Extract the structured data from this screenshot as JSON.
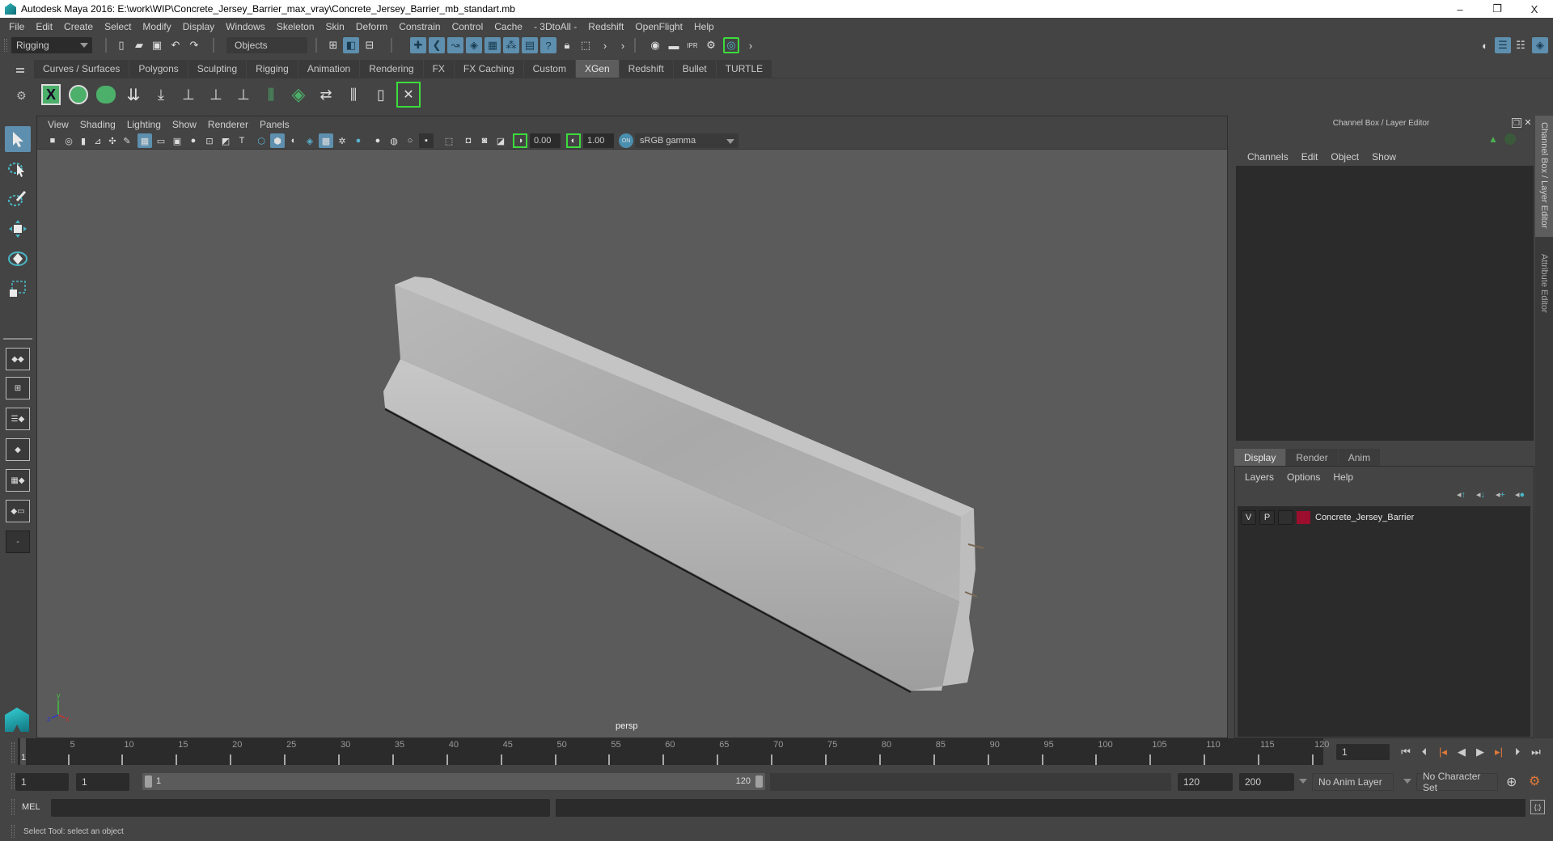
{
  "window": {
    "title": "Autodesk Maya 2016: E:\\work\\WIP\\Concrete_Jersey_Barrier_max_vray\\Concrete_Jersey_Barrier_mb_standart.mb",
    "minimize": "–",
    "restore": "❐",
    "close": "X"
  },
  "menubar": [
    "File",
    "Edit",
    "Create",
    "Select",
    "Modify",
    "Display",
    "Windows",
    "Skeleton",
    "Skin",
    "Deform",
    "Constrain",
    "Control",
    "Cache",
    "- 3DtoAll -",
    "Redshift",
    "OpenFlight",
    "Help"
  ],
  "statusline": {
    "menuset": "Rigging",
    "selection_mode": "Objects"
  },
  "shelf": {
    "tabs": [
      "Curves / Surfaces",
      "Polygons",
      "Sculpting",
      "Rigging",
      "Animation",
      "Rendering",
      "FX",
      "FX Caching",
      "Custom",
      "XGen",
      "Redshift",
      "Bullet",
      "TURTLE"
    ],
    "active_tab": "XGen",
    "icons": [
      "xgen-window-icon",
      "xgen-preview-icon",
      "xgen-clear-preview-icon",
      "add-guides-icon",
      "place-guide-icon",
      "add-guide-icon",
      "sculpt-guide-icon",
      "lock-guide-icon",
      "rebuild-guides-icon",
      "xgen-patch-icon",
      "bend-guide-icon",
      "select-guides-icon",
      "guides-to-curves-icon",
      "xgen-toggle-icon"
    ]
  },
  "viewport": {
    "menu": [
      "View",
      "Shading",
      "Lighting",
      "Show",
      "Renderer",
      "Panels"
    ],
    "exposure": "0.00",
    "gamma": "1.00",
    "color_space": "sRGB gamma",
    "camera_label": "persp",
    "axis_labels": {
      "x": "x",
      "y": "y",
      "z": "z"
    },
    "object": "Concrete_Jersey_Barrier"
  },
  "channel_box": {
    "title": "Channel Box / Layer Editor",
    "menu": [
      "Channels",
      "Edit",
      "Object",
      "Show"
    ]
  },
  "layer_editor": {
    "tabs": [
      "Display",
      "Render",
      "Anim"
    ],
    "active_tab": "Display",
    "menu": [
      "Layers",
      "Options",
      "Help"
    ],
    "layers": [
      {
        "visible": "V",
        "playback": "P",
        "name": "Concrete_Jersey_Barrier",
        "color": "#9b0e2e"
      }
    ]
  },
  "side_tabs": [
    "Channel Box / Layer Editor",
    "Attribute Editor"
  ],
  "timeline": {
    "start": 1,
    "end": 120,
    "ticks": [
      "5",
      "10",
      "15",
      "20",
      "25",
      "30",
      "35",
      "40",
      "45",
      "50",
      "55",
      "60",
      "65",
      "70",
      "75",
      "80",
      "85",
      "90",
      "95",
      "100",
      "105",
      "110",
      "115",
      "120"
    ],
    "current_frame": "1",
    "current_frame_field": "1"
  },
  "range": {
    "anim_start": "1",
    "playback_start": "1",
    "slider_start": "1",
    "slider_end": "120",
    "playback_end": "120",
    "anim_end": "200",
    "anim_layer": "No Anim Layer",
    "character_set": "No Character Set"
  },
  "command_line": {
    "label": "MEL",
    "value": ""
  },
  "help_line": "Select Tool: select an object",
  "colors": {
    "accent_blue": "#5e8fae",
    "xgen_green": "#4caf6a",
    "playback_orange": "#e07a3a",
    "layer_red": "#9b0e2e"
  }
}
